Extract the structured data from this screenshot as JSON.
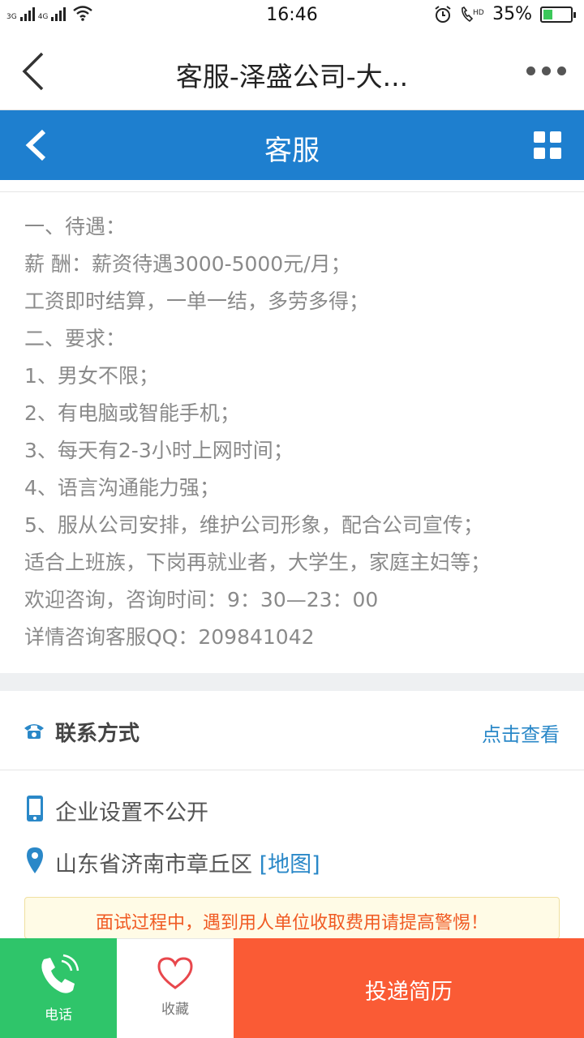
{
  "status_bar": {
    "net_1": "3G",
    "net_2": "4G",
    "time": "16:46",
    "battery_pct": "35%",
    "battery_level": 0.35
  },
  "title_bar": {
    "title": "客服-泽盛公司-大..."
  },
  "header": {
    "title": "客服"
  },
  "description": {
    "lines": [
      "一、待遇：",
      "薪 酬：薪资待遇3000-5000元/月；",
      "工资即时结算，一单一结，多劳多得；",
      "二、要求：",
      "1、男女不限；",
      "2、有电脑或智能手机；",
      "3、每天有2-3小时上网时间；",
      "4、语言沟通能力强；",
      "5、服从公司安排，维护公司形象，配合公司宣传；",
      "适合上班族，下岗再就业者，大学生，家庭主妇等；",
      "欢迎咨询，咨询时间：9：30—23：00",
      "详情咨询客服QQ：209841042"
    ]
  },
  "contact": {
    "title": "联系方式",
    "view_link": "点击查看",
    "phone_text": "企业设置不公开",
    "address_text": "山东省济南市章丘区 ",
    "map_link": "[地图]"
  },
  "warning": "面试过程中，遇到用人单位收取费用请提高警惕！",
  "bottom": {
    "phone_label": "电话",
    "favorite_label": "收藏",
    "apply_label": "投递简历"
  },
  "colors": {
    "header_blue": "#1e7fcf",
    "phone_green": "#2fc56a",
    "apply_orange": "#fa5b35",
    "link_blue": "#2a88c8"
  }
}
